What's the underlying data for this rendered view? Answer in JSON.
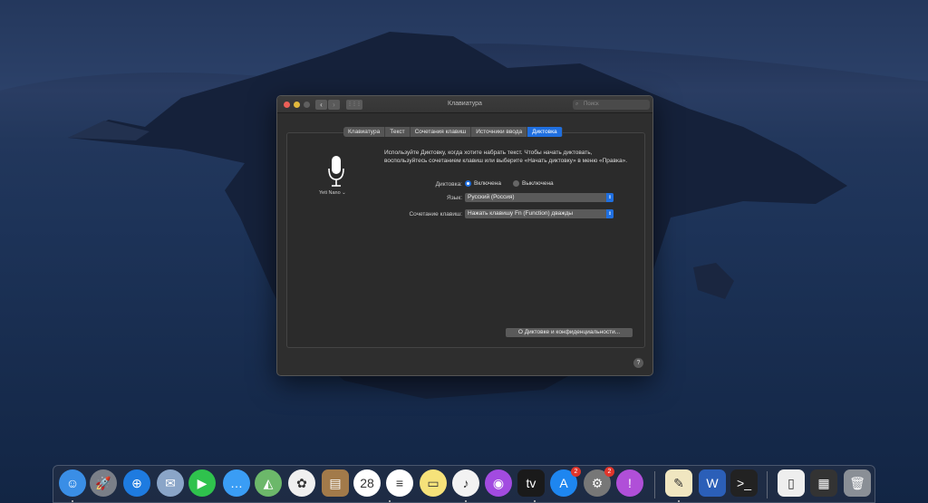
{
  "window": {
    "title": "Клавиатура",
    "search_placeholder": "Поиск",
    "back": "‹",
    "forward": "›",
    "grid": "⋮⋮⋮"
  },
  "tabs": [
    {
      "label": "Клавиатура"
    },
    {
      "label": "Текст"
    },
    {
      "label": "Сочетания клавиш"
    },
    {
      "label": "Источники ввода"
    },
    {
      "label": "Диктовка",
      "active": true
    }
  ],
  "dictation": {
    "mic_name": "Yeti Nano ⌄",
    "description": "Используйте Диктовку, когда хотите набрать текст. Чтобы начать диктовать, воспользуйтесь сочетанием клавиш или выберите «Начать диктовку» в меню «Правка».",
    "dictation_label": "Диктовка:",
    "on_label": "Включена",
    "off_label": "Выключена",
    "selected": "on",
    "language_label": "Язык:",
    "language_value": "Русский (Россия)",
    "shortcut_label": "Сочетание клавиш:",
    "shortcut_value": "Нажать клавишу Fn (Function) дважды",
    "about_button": "О Диктовке и конфиденциальности...",
    "help": "?"
  },
  "dock": {
    "apps": [
      {
        "name": "finder",
        "glyph": "☺",
        "color": "#3a8ee6"
      },
      {
        "name": "launchpad",
        "glyph": "🚀",
        "color": "#7a7f88"
      },
      {
        "name": "safari",
        "glyph": "⊕",
        "color": "#1e7be0"
      },
      {
        "name": "mail-stamp",
        "glyph": "✉",
        "color": "#8aa5c8"
      },
      {
        "name": "facetime",
        "glyph": "▶",
        "color": "#2fc24d"
      },
      {
        "name": "messages",
        "glyph": "…",
        "color": "#3a9df5"
      },
      {
        "name": "maps",
        "glyph": "◭",
        "color": "#6cb86a"
      },
      {
        "name": "photos",
        "glyph": "✿",
        "color": "#f0f0f0"
      },
      {
        "name": "contacts",
        "glyph": "▤",
        "color": "#a27a4a"
      },
      {
        "name": "calendar",
        "glyph": "28",
        "color": "#ffffff"
      },
      {
        "name": "reminders",
        "glyph": "≡",
        "color": "#ffffff"
      },
      {
        "name": "notes",
        "glyph": "▭",
        "color": "#f6e27a"
      },
      {
        "name": "music",
        "glyph": "♪",
        "color": "#f2f2f2"
      },
      {
        "name": "podcasts",
        "glyph": "◉",
        "color": "#a24be0"
      },
      {
        "name": "tv",
        "glyph": "tv",
        "color": "#1a1a1a"
      },
      {
        "name": "app-store",
        "glyph": "A",
        "color": "#1e86f0",
        "badge": "2"
      },
      {
        "name": "system-preferences",
        "glyph": "⚙",
        "color": "#777",
        "badge": "2"
      },
      {
        "name": "feedback",
        "glyph": "!",
        "color": "#b04fd8"
      },
      {
        "name": "textedit",
        "glyph": "✎",
        "color": "#f0e6c0"
      },
      {
        "name": "word",
        "glyph": "W",
        "color": "#2b5fb8"
      },
      {
        "name": "terminal",
        "glyph": ">_",
        "color": "#222"
      },
      {
        "name": "preview-doc",
        "glyph": "▯",
        "color": "#eee"
      },
      {
        "name": "downloads-stack",
        "glyph": "▦",
        "color": "#333"
      },
      {
        "name": "trash",
        "glyph": "🗑",
        "color": "#8a8f96"
      }
    ]
  }
}
